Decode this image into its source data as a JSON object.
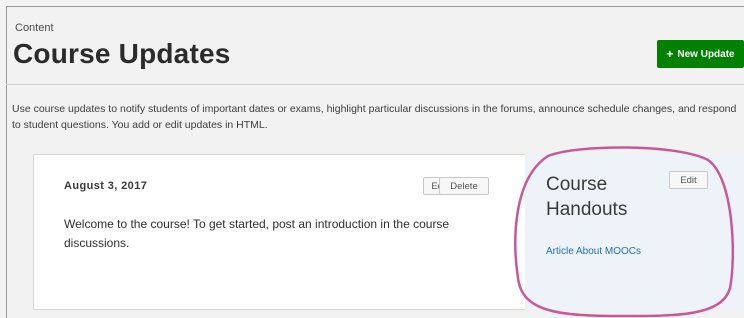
{
  "header": {
    "eyebrow": "Content",
    "title": "Course Updates",
    "new_update_label": "New Update",
    "new_update_icon": "plus-icon"
  },
  "intro_text": "Use course updates to notify students of important dates or exams, highlight particular discussions in the forums, announce schedule changes, and respond to student questions. You add or edit updates in HTML.",
  "update": {
    "date": "August 3, 2017",
    "edit_label": "Edit",
    "delete_label": "Delete",
    "body": "Welcome to the course! To get started, post an introduction in the course discussions."
  },
  "handouts": {
    "title": "Course Handouts",
    "edit_label": "Edit",
    "links": [
      "Article About MOOCs"
    ]
  },
  "colors": {
    "primary_button": "#008100",
    "link": "#1d6fb8",
    "highlight_circle": "#c9579a",
    "handouts_bg": "#edf3f9"
  }
}
